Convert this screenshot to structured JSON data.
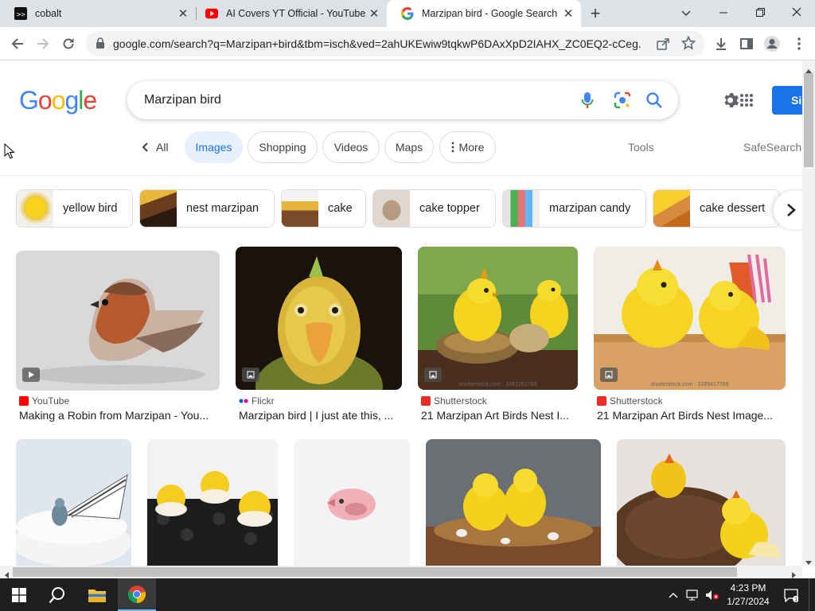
{
  "browser": {
    "tabs": [
      {
        "title": "cobalt",
        "icon": "cobalt-favicon",
        "active": false
      },
      {
        "title": "AI Covers YT Official - YouTube",
        "icon": "youtube-favicon",
        "active": false
      },
      {
        "title": "Marzipan bird - Google Search",
        "icon": "google-favicon",
        "active": true
      }
    ],
    "url": "google.com/search?q=Marzipan+bird&tbm=isch&ved=2ahUKEwiw9tqkwP6DAxXpD2IAHX_ZC0EQ2-cCeg...",
    "close_glyph": "✕",
    "new_tab_glyph": "+"
  },
  "search": {
    "logo": [
      "G",
      "o",
      "o",
      "g",
      "l",
      "e"
    ],
    "logo_colors": [
      "#4285f4",
      "#ea4335",
      "#fbbc05",
      "#4285f4",
      "#34a853",
      "#ea4335"
    ],
    "query": "Marzipan bird",
    "signin_label": "Si"
  },
  "filters": {
    "all": "All",
    "tabs": [
      "Images",
      "Shopping",
      "Videos",
      "Maps",
      "More"
    ],
    "tools": "Tools",
    "safesearch": "SafeSearch"
  },
  "related": [
    {
      "label": "yellow bird"
    },
    {
      "label": "nest marzipan"
    },
    {
      "label": "cake"
    },
    {
      "label": "cake topper"
    },
    {
      "label": "marzipan candy"
    },
    {
      "label": "cake dessert"
    }
  ],
  "results_row1": [
    {
      "source": "YouTube",
      "title": "Making a Robin from Marzipan - You...",
      "fav_color": "#ff0000",
      "badge": "video-icon"
    },
    {
      "source": "Flickr",
      "title": "Marzipan bird | I just ate this, ...",
      "fav_color": "#0063dc",
      "badge": "image-icon"
    },
    {
      "source": "Shutterstock",
      "title": "21 Marzipan Art Birds Nest I...",
      "fav_color": "#ee2b24",
      "badge": "image-icon",
      "watermark": "shutterstock.com · 1061261783"
    },
    {
      "source": "Shutterstock",
      "title": "21 Marzipan Art Birds Nest Image...",
      "fav_color": "#ee2b24",
      "badge": "image-icon",
      "watermark": "shutterstock.com · 2289417769"
    }
  ],
  "taskbar": {
    "time": "4:23 PM",
    "date": "1/27/2024"
  }
}
